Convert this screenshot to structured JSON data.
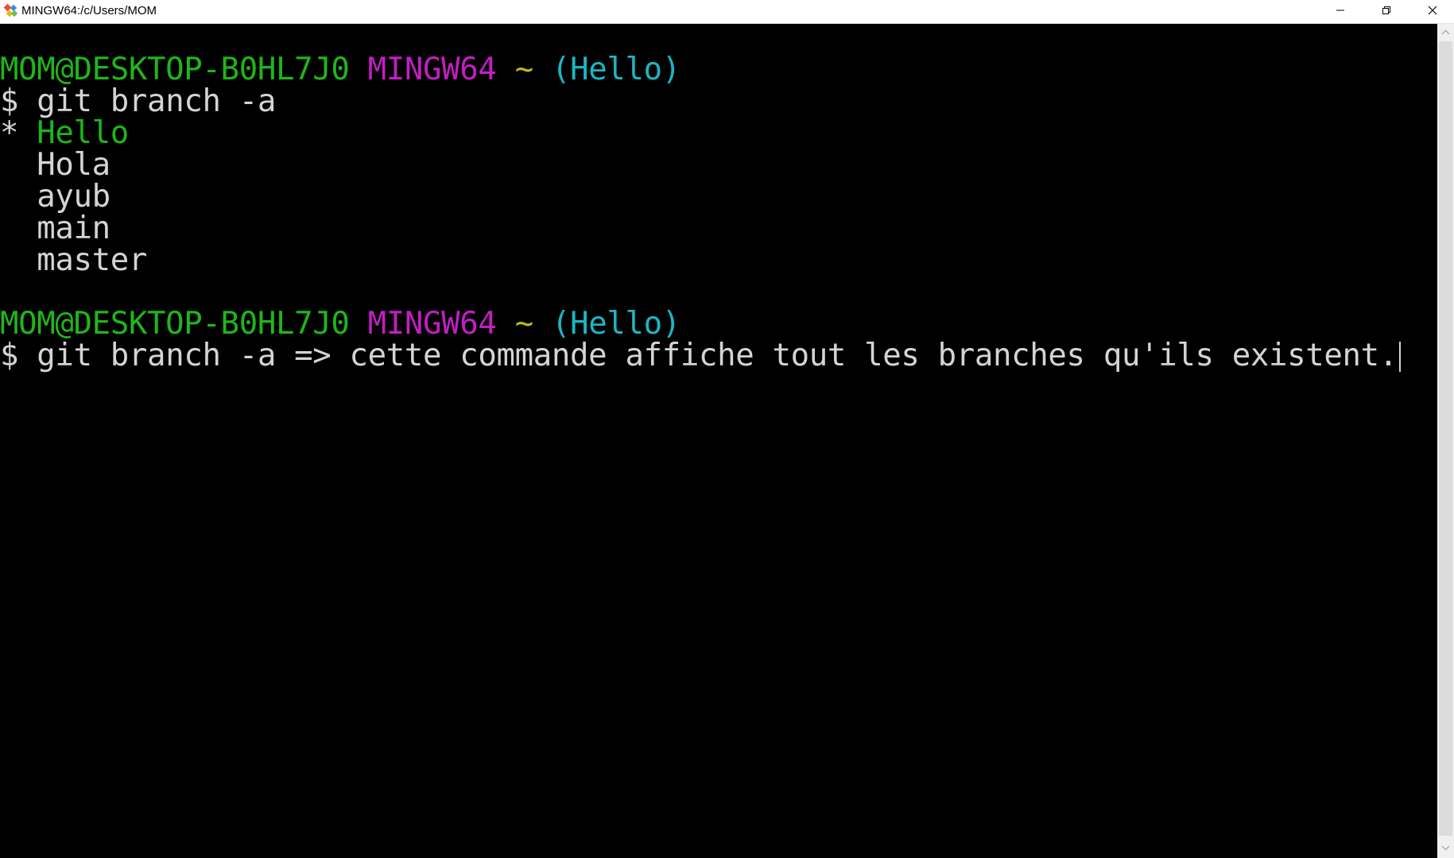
{
  "window": {
    "title": "MINGW64:/c/Users/MOM",
    "app_icon": "git-bash-icon",
    "buttons": [
      "minimize-icon",
      "restore-icon",
      "close-icon"
    ]
  },
  "colors": {
    "background": "#000000",
    "user_host": "#1fb619",
    "shell": "#c21ec2",
    "path": "#c2b91c",
    "branch": "#1ab6c4",
    "text": "#d4d4d4"
  },
  "terminal": {
    "prompt1": {
      "user_host": "MOM@DESKTOP-B0HL7J0",
      "shell": "MINGW64",
      "path": "~",
      "branch": "(Hello)"
    },
    "command1": {
      "symbol": "$",
      "text": "git branch -a"
    },
    "branches": [
      {
        "marker": "*",
        "name": "Hello",
        "current": true
      },
      {
        "marker": "",
        "name": "Hola",
        "current": false
      },
      {
        "marker": "",
        "name": "ayub",
        "current": false
      },
      {
        "marker": "",
        "name": "main",
        "current": false
      },
      {
        "marker": "",
        "name": "master",
        "current": false
      }
    ],
    "prompt2": {
      "user_host": "MOM@DESKTOP-B0HL7J0",
      "shell": "MINGW64",
      "path": "~",
      "branch": "(Hello)"
    },
    "command2": {
      "symbol": "$",
      "text": "git branch -a => cette commande affiche tout les branches qu'ils existent."
    }
  }
}
